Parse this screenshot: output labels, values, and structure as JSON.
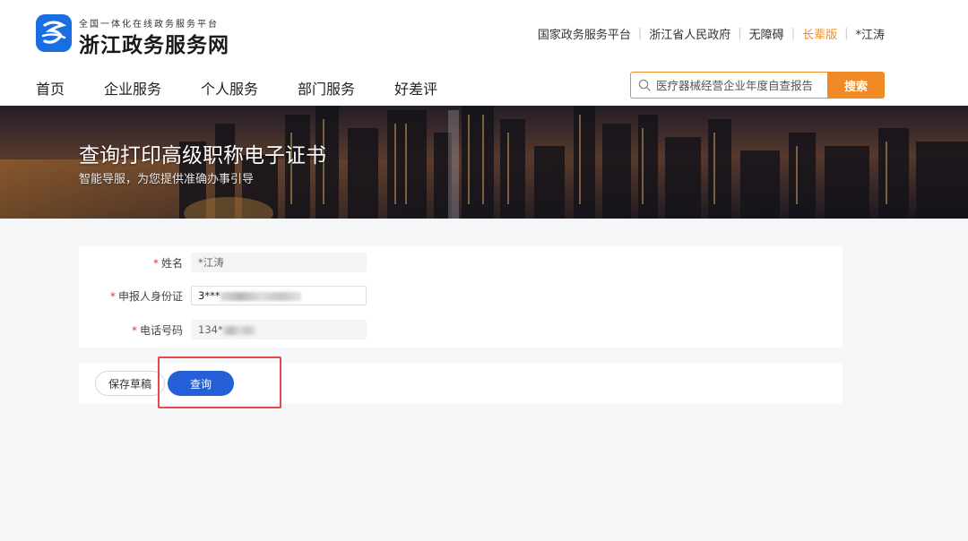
{
  "header": {
    "logo_subtitle": "全国一体化在线政务服务平台",
    "logo_title": "浙江政务服务网",
    "top_links": [
      "国家政务服务平台",
      "浙江省人民政府",
      "无障碍",
      "长辈版",
      "*江涛"
    ],
    "nav": [
      "首页",
      "企业服务",
      "个人服务",
      "部门服务",
      "好差评"
    ],
    "search": {
      "placeholder": "医疗器械经营企业年度自查报告",
      "button_label": "搜索"
    }
  },
  "banner": {
    "title": "查询打印高级职称电子证书",
    "subtitle": "智能导服，为您提供准确办事引导"
  },
  "form": {
    "name_label": "姓名",
    "name_value": "*江涛",
    "id_label": "申报人身份证",
    "id_value": "3***",
    "phone_label": "电话号码",
    "phone_value": "134*"
  },
  "actions": {
    "save_draft": "保存草稿",
    "query": "查询"
  },
  "colors": {
    "accent_orange": "#f08a24",
    "primary_blue": "#2660d8",
    "highlight_red": "#e5484d",
    "logo_blue": "#1a6fe0"
  }
}
